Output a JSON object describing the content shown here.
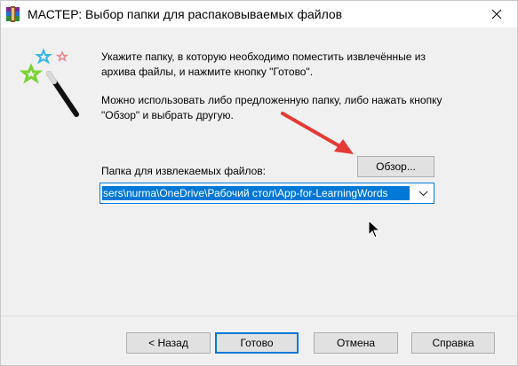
{
  "window": {
    "title": "МАСТЕР:  Выбор папки для распаковываемых файлов",
    "close_glyph": "✕"
  },
  "instructions": {
    "line1": "Укажите папку, в которую необходимо поместить извлечённые из архива файлы, и нажмите кнопку \"Готово\".",
    "line2": "Можно использовать либо предложенную папку, либо нажать кнопку \"Обзор\" и выбрать другую."
  },
  "folder": {
    "label": "Папка для извлекаемых файлов:",
    "browse_label": "Обзор...",
    "path_value": "sers\\nurma\\OneDrive\\Рабочий стол\\App-for-LearningWords"
  },
  "footer": {
    "back_label": "< Назад",
    "ok_label": "Готово",
    "cancel_label": "Отмена",
    "help_label": "Справка"
  },
  "icons": {
    "app": "winrar-books-icon",
    "wizard": "magic-wand-stars-icon",
    "annotation": "red-arrow-annotation",
    "pointer": "mouse-cursor-icon"
  },
  "colors": {
    "accent": "#0078d7",
    "annotation": "#e53935",
    "button_face": "#e1e1e1",
    "dialog_bg": "#f0f0f0"
  }
}
